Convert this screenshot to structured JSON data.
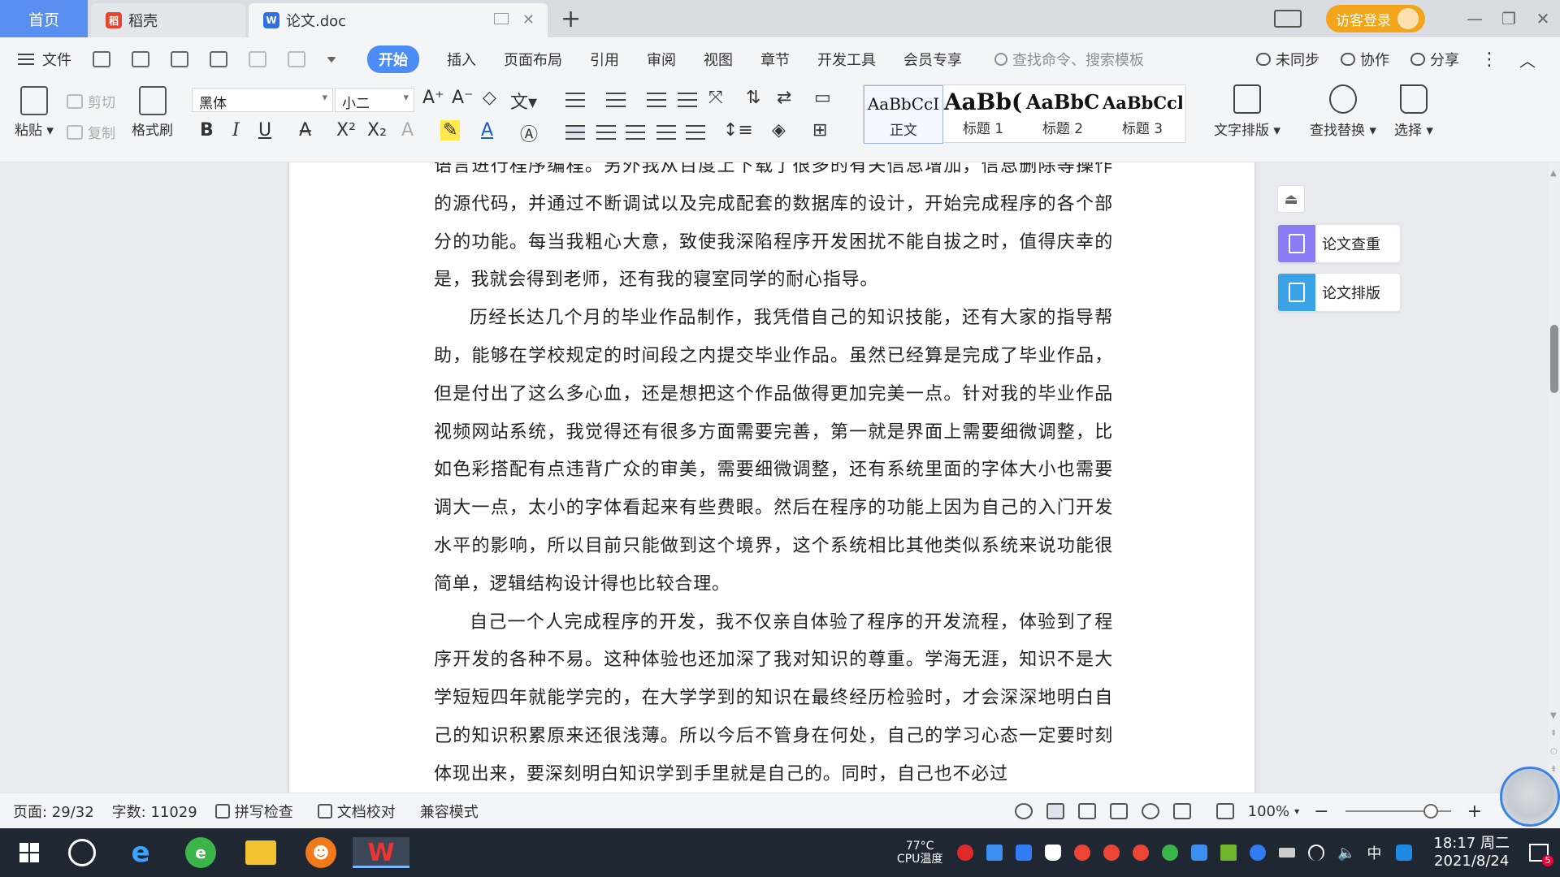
{
  "titlebar": {
    "home_tab": "首页",
    "daoke_tab": "稻壳",
    "doc_tab": "论文.doc",
    "visitor_login": "访客登录"
  },
  "menu": {
    "file": "文件",
    "items": [
      "开始",
      "插入",
      "页面布局",
      "引用",
      "审阅",
      "视图",
      "章节",
      "开发工具",
      "会员专享"
    ],
    "search_placeholder": "查找命令、搜索模板",
    "unsync": "未同步",
    "collab": "协作",
    "share": "分享"
  },
  "ribbon": {
    "paste": "粘贴",
    "cut": "剪切",
    "copy": "复制",
    "format_painter": "格式刷",
    "font_name": "黑体",
    "font_size": "小二",
    "styles": [
      {
        "preview": "AaBbCcI",
        "name": "正文"
      },
      {
        "preview": "AaBb(",
        "name": "标题 1"
      },
      {
        "preview": "AaBbC",
        "name": "标题 2"
      },
      {
        "preview": "AaBbCcl",
        "name": "标题 3"
      }
    ],
    "text_layout": "文字排版",
    "find_replace": "查找替换",
    "select": "选择"
  },
  "document": {
    "paragraphs": [
      "语言进行程序编程。另外我从百度上下载了很多的有关信息增加，信息删除等操作的源代码，并通过不断调试以及完成配套的数据库的设计，开始完成程序的各个部分的功能。每当我粗心大意，致使我深陷程序开发困扰不能自拔之时，值得庆幸的是，我就会得到老师，还有我的寝室同学的耐心指导。",
      "历经长达几个月的毕业作品制作，我凭借自己的知识技能，还有大家的指导帮助，能够在学校规定的时间段之内提交毕业作品。虽然已经算是完成了毕业作品，但是付出了这么多心血，还是想把这个作品做得更加完美一点。针对我的毕业作品视频网站系统，我觉得还有很多方面需要完善，第一就是界面上需要细微调整，比如色彩搭配有点违背广众的审美，需要细微调整，还有系统里面的字体大小也需要调大一点，太小的字体看起来有些费眼。然后在程序的功能上因为自己的入门开发水平的影响，所以目前只能做到这个境界，这个系统相比其他类似系统来说功能很简单，逻辑结构设计得也比较合理。",
      "自己一个人完成程序的开发，我不仅亲自体验了程序的开发流程，体验到了程序开发的各种不易。这种体验也还加深了我对知识的尊重。学海无涯，知识不是大学短短四年就能学完的，在大学学到的知识在最终经历检验时，才会深深地明白自己的知识积累原来还很浅薄。所以今后不管身在何处，自己的学习心态一定要时刻体现出来，要深刻明白知识学到手里就是自己的。同时，自己也不必过"
    ]
  },
  "side_panel": {
    "check": "论文查重",
    "layout": "论文排版"
  },
  "status": {
    "page": "页面: 29/32",
    "words": "字数: 11029",
    "spell": "拼写检查",
    "proof": "文档校对",
    "compat": "兼容模式",
    "zoom": "100%"
  },
  "taskbar": {
    "cpu_temp": "77°C",
    "cpu_label": "CPU温度",
    "ime": "中",
    "time": "18:17 周二",
    "date": "2021/8/24"
  },
  "colors": {
    "accent": "#4c8df5",
    "visitor": "#f2a51a",
    "check_icon": "#8b7cf6",
    "layout_icon": "#3aa3e8"
  }
}
